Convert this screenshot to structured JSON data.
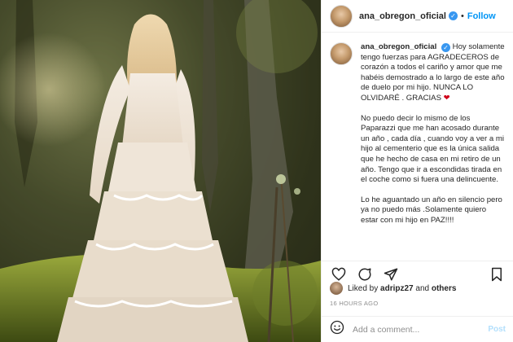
{
  "post": {
    "username": "ana_obregon_oficial",
    "follow_label": "Follow",
    "separator": "•"
  },
  "caption": {
    "username": "ana_obregon_oficial",
    "paragraphs": [
      "Hoy solamente tengo fuerzas para AGRADECEROS de corazón a todos el cariño y amor que me habéis demostrado a lo largo de este año de duelo por mi hijo. NUNCA LO OLVIDARÉ . GRACIAS",
      "No puedo decir lo mismo de los Paparazzi que me han acosado durante un año , cada día , cuando voy a ver a mi hijo al cementerio que es la única salida que he hecho de casa en mi retiro de un año. Tengo que ir a escondidas tirada en el coche como si fuera una delincuente.",
      "Lo he aguantado un año en silencio pero ya no puedo más .Solamente quiero estar con mi hijo en PAZ!!!!"
    ],
    "heart": "❤"
  },
  "likes": {
    "prefix": "Liked by",
    "user": "adripz27",
    "and": "and",
    "others": "others"
  },
  "timestamp": "16 HOURS AGO",
  "comment": {
    "placeholder": "Add a comment...",
    "post_label": "Post"
  },
  "colors": {
    "link_blue": "#0095f6",
    "verified_blue": "#3897f0",
    "heart_red": "#d0021b"
  },
  "icons": [
    "heart-icon",
    "comment-icon",
    "share-icon",
    "bookmark-icon",
    "emoji-icon",
    "verified-icon"
  ]
}
